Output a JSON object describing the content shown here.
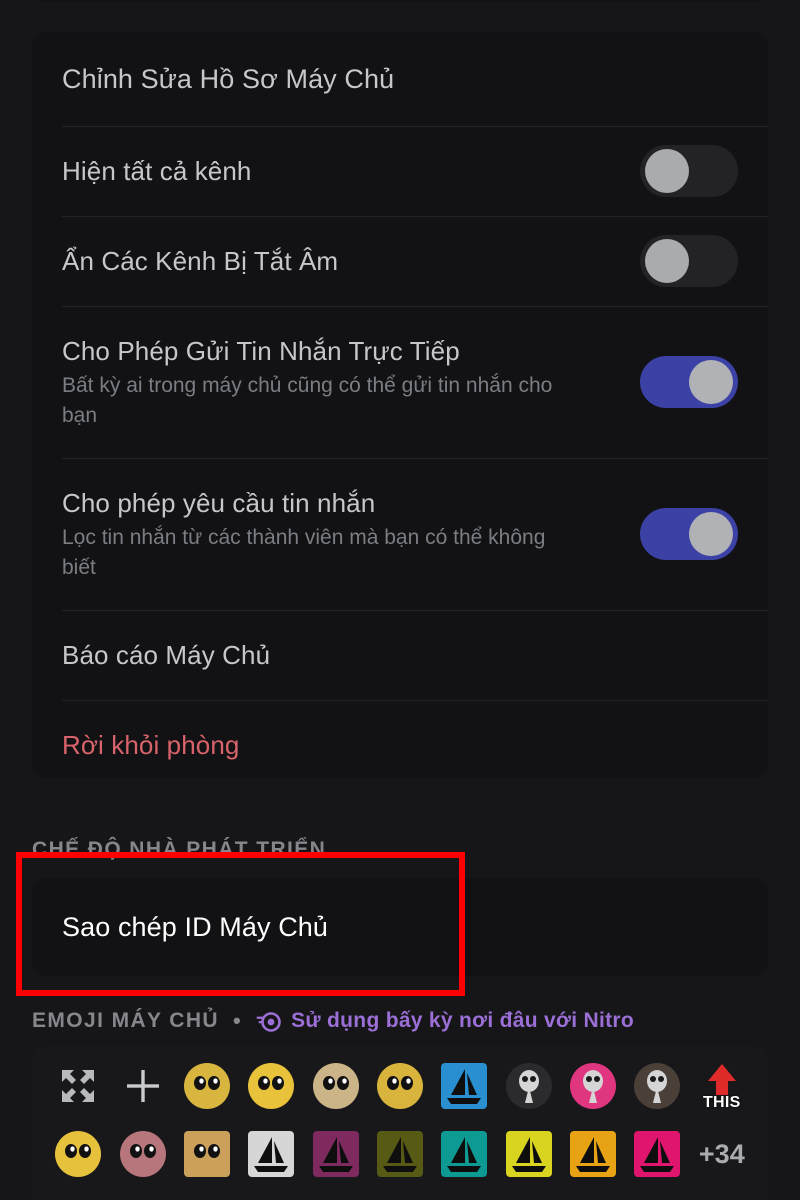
{
  "window": {
    "background": "#161618",
    "card_background": "#121214"
  },
  "settings_card": {
    "header": {
      "label": "Chỉnh Sửa Hồ Sơ Máy Chủ"
    },
    "rows": [
      {
        "title": "Hiện tất cả kênh",
        "subtitle": "",
        "toggle": "off"
      },
      {
        "title": "Ẩn Các Kênh Bị Tắt Âm",
        "subtitle": "",
        "toggle": "off"
      },
      {
        "title": "Cho Phép Gửi Tin Nhắn Trực Tiếp",
        "subtitle": "Bất kỳ ai trong máy chủ cũng có thể gửi tin nhắn cho bạn",
        "toggle": "on"
      },
      {
        "title": "Cho phép yêu cầu tin nhắn",
        "subtitle": "Lọc tin nhắn từ các thành viên mà bạn có thể không biết",
        "toggle": "on"
      },
      {
        "title": "Báo cáo Máy Chủ",
        "subtitle": "",
        "toggle": "none"
      },
      {
        "title": "Rời khỏi phòng",
        "subtitle": "",
        "toggle": "none",
        "danger": true
      }
    ],
    "toggle_on_color": "#3b41a5",
    "toggle_off_color": "#232327",
    "danger_color": "#d8636a"
  },
  "developer_section": {
    "header": "CHẾ ĐỘ NHÀ PHÁT TRIỂN",
    "copy_id_label": "Sao chép ID Máy Chủ"
  },
  "annotation": {
    "color": "#ff0000",
    "target": "Sao chép ID Máy Chủ"
  },
  "emoji_section": {
    "header": "EMOJI MÁY CHỦ",
    "separator": "•",
    "nitro_icon": "nitro-icon",
    "nitro_text": "Sử dụng bấy kỳ nơi đâu với Nitro",
    "nitro_color": "#9b6fd6",
    "row1": [
      {
        "name": "expand-icon",
        "kind": "expand"
      },
      {
        "name": "add-emoji-icon",
        "kind": "plus"
      },
      {
        "name": "emoji-spongebob-eyes",
        "kind": "emoji",
        "color": "#d8b53f",
        "shape": "round"
      },
      {
        "name": "emoji-blush-eyes",
        "kind": "emoji",
        "color": "#e8c23a",
        "shape": "round"
      },
      {
        "name": "emoji-crying-figure",
        "kind": "emoji",
        "color": "#cbb487",
        "shape": "round"
      },
      {
        "name": "emoji-big-eyes",
        "kind": "emoji",
        "color": "#d9b43c",
        "shape": "round"
      },
      {
        "name": "emoji-sail-blue",
        "kind": "emoji",
        "color": "#2a8fd0",
        "shape": "square"
      },
      {
        "name": "emoji-skull-heart",
        "kind": "emoji",
        "color": "#2b2b2e",
        "shape": "round"
      },
      {
        "name": "emoji-plague-rainbow",
        "kind": "emoji",
        "color": "#e0357f",
        "shape": "round"
      },
      {
        "name": "emoji-plague-doctor",
        "kind": "emoji",
        "color": "#4a4038",
        "shape": "round"
      },
      {
        "name": "emoji-this-arrow",
        "kind": "this",
        "color": "#e02b2b",
        "label": "THIS"
      }
    ],
    "row2": [
      {
        "name": "emoji-pleading-face",
        "kind": "emoji",
        "color": "#e6c23c",
        "shape": "round"
      },
      {
        "name": "emoji-brain-creature",
        "kind": "emoji",
        "color": "#b6767c",
        "shape": "round"
      },
      {
        "name": "emoji-lamp-eyes",
        "kind": "emoji",
        "color": "#caa05a",
        "shape": "square"
      },
      {
        "name": "emoji-sail-white",
        "kind": "emoji",
        "color": "#d6d6d6",
        "shape": "square"
      },
      {
        "name": "emoji-sail-purple",
        "kind": "emoji",
        "color": "#7e2a5e",
        "shape": "square"
      },
      {
        "name": "emoji-sail-olive",
        "kind": "emoji",
        "color": "#565a14",
        "shape": "square"
      },
      {
        "name": "emoji-sail-teal",
        "kind": "emoji",
        "color": "#0d9a93",
        "shape": "square"
      },
      {
        "name": "emoji-sail-yellow",
        "kind": "emoji",
        "color": "#d8d420",
        "shape": "square"
      },
      {
        "name": "emoji-sail-orange",
        "kind": "emoji",
        "color": "#e8a314",
        "shape": "square"
      },
      {
        "name": "emoji-sail-pink",
        "kind": "emoji",
        "color": "#e0156e",
        "shape": "square"
      },
      {
        "name": "emoji-overflow-count",
        "kind": "count",
        "label": "+34"
      }
    ]
  }
}
